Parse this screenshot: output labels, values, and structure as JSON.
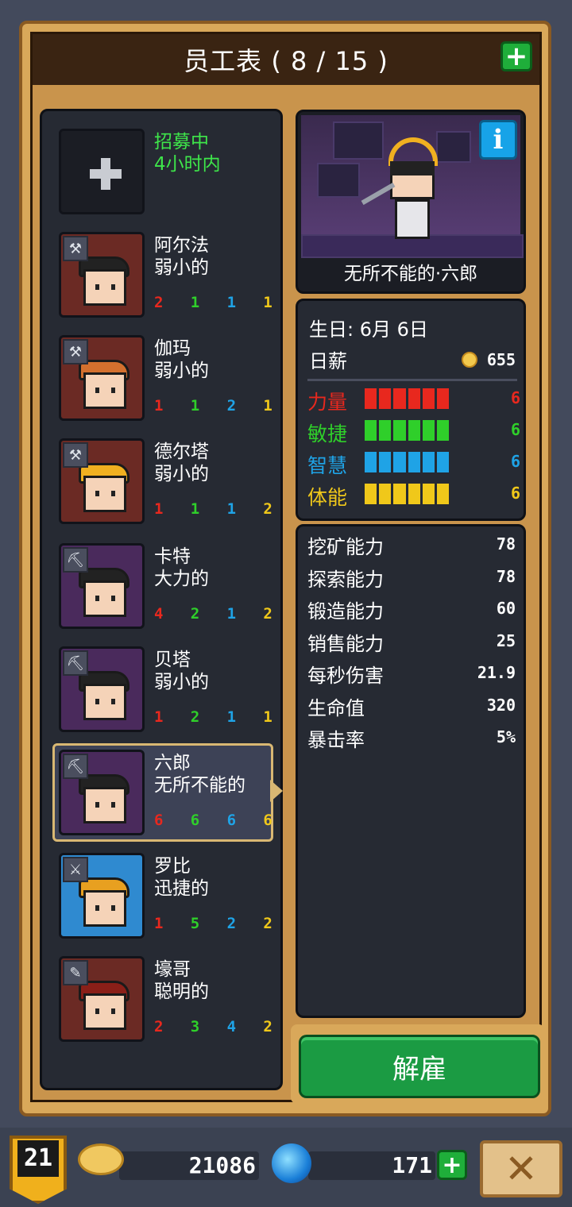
{
  "title": "员工表 ( 8 / 15 )",
  "add_icon": "plus-icon",
  "recruit": {
    "line1": "招募中",
    "line2": "4小时内"
  },
  "staff": [
    {
      "name": "阿尔法",
      "trait": "弱小的",
      "stats": [
        "2",
        "1",
        "1",
        "1"
      ],
      "tool": "hammer-icon",
      "bg": "#6b2a24",
      "hair": "#222222"
    },
    {
      "name": "伽玛",
      "trait": "弱小的",
      "stats": [
        "1",
        "1",
        "2",
        "1"
      ],
      "tool": "hammer-icon",
      "bg": "#6b2a24",
      "hair": "#d3702e"
    },
    {
      "name": "德尔塔",
      "trait": "弱小的",
      "stats": [
        "1",
        "1",
        "1",
        "2"
      ],
      "tool": "hammer-icon",
      "bg": "#6b2a24",
      "hair": "#f0b020"
    },
    {
      "name": "卡特",
      "trait": "大力的",
      "stats": [
        "4",
        "2",
        "1",
        "2"
      ],
      "tool": "pickaxe-icon",
      "bg": "#4a2a5c",
      "hair": "#222222"
    },
    {
      "name": "贝塔",
      "trait": "弱小的",
      "stats": [
        "1",
        "2",
        "1",
        "1"
      ],
      "tool": "pickaxe-icon",
      "bg": "#4a2a5c",
      "hair": "#222222"
    },
    {
      "name": "六郎",
      "trait": "无所不能的",
      "stats": [
        "6",
        "6",
        "6",
        "6"
      ],
      "tool": "pickaxe-icon",
      "bg": "#4a2a5c",
      "hair": "#222222"
    },
    {
      "name": "罗比",
      "trait": "迅捷的",
      "stats": [
        "1",
        "5",
        "2",
        "2"
      ],
      "tool": "sword-icon",
      "bg": "#2f8ad0",
      "hair": "#e8a020"
    },
    {
      "name": "壕哥",
      "trait": "聪明的",
      "stats": [
        "2",
        "3",
        "4",
        "2"
      ],
      "tool": "axe-icon",
      "bg": "#6b2a24",
      "hair": "#8a1f18"
    }
  ],
  "selected": {
    "name": "无所不能的·六郎",
    "info_icon": "info-icon",
    "birthday_label": "生日:",
    "birthday_value": "6月 6日",
    "wage_label": "日薪",
    "wage_value": "655",
    "attrs": [
      {
        "label": "力量",
        "value": "6",
        "filled": 6,
        "max": 6,
        "color": "#e8281e"
      },
      {
        "label": "敏捷",
        "value": "6",
        "filled": 6,
        "max": 6,
        "color": "#2fcf2a"
      },
      {
        "label": "智慧",
        "value": "6",
        "filled": 6,
        "max": 6,
        "color": "#1fa3e6"
      },
      {
        "label": "体能",
        "value": "6",
        "filled": 6,
        "max": 6,
        "color": "#f0c81a"
      }
    ],
    "abilities": [
      {
        "label": "挖矿能力",
        "value": "78"
      },
      {
        "label": "探索能力",
        "value": "78"
      },
      {
        "label": "锻造能力",
        "value": "60"
      },
      {
        "label": "销售能力",
        "value": "25"
      },
      {
        "label": "每秒伤害",
        "value": "21.9"
      },
      {
        "label": "生命值",
        "value": "320"
      },
      {
        "label": "暴击率",
        "value": "5%"
      }
    ]
  },
  "fire_button": "解雇",
  "footer": {
    "level": "21",
    "gold": "21086",
    "gems": "171",
    "close_icon": "close-icon"
  }
}
